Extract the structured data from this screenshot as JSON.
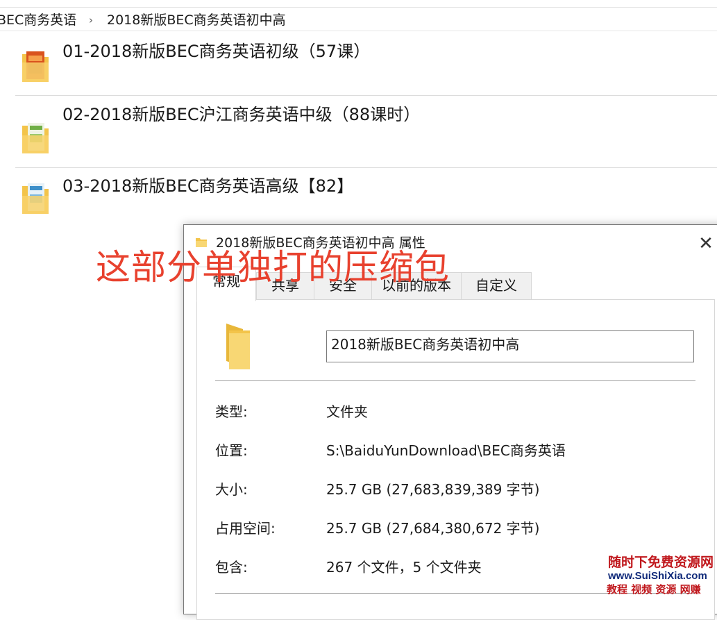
{
  "breadcrumb": {
    "parent": "BEC商务英语",
    "separator": "›",
    "current": "2018新版BEC商务英语初中高"
  },
  "folders": [
    {
      "name": "01-2018新版BEC商务英语初级（57课）",
      "icon": "folder-book-icon-orange"
    },
    {
      "name": "02-2018新版BEC沪江商务英语中级（88课时）",
      "icon": "folder-book-icon-green"
    },
    {
      "name": "03-2018新版BEC商务英语高级【82】",
      "icon": "folder-book-icon-blue"
    }
  ],
  "annotation": "这部分单独打的压缩包",
  "dialog": {
    "title": "2018新版BEC商务英语初中高 属性",
    "close_glyph": "✕",
    "tabs": [
      "常规",
      "共享",
      "安全",
      "以前的版本",
      "自定义"
    ],
    "active_tab": "常规",
    "folder_name": "2018新版BEC商务英语初中高",
    "properties": [
      {
        "label": "类型:",
        "value": "文件夹"
      },
      {
        "label": "位置:",
        "value": "S:\\BaiduYunDownload\\BEC商务英语"
      },
      {
        "label": "大小:",
        "value": "25.7 GB (27,683,839,389 字节)"
      },
      {
        "label": "占用空间:",
        "value": "25.7 GB (27,684,380,672 字节)"
      },
      {
        "label": "包含:",
        "value": "267 个文件，5 个文件夹"
      }
    ]
  },
  "watermark": {
    "line1": "随时下免费资源网",
    "line2": "www.SuiShiXia.com",
    "line3": "教程 视频 资源 网赚"
  },
  "colors": {
    "annotation": "#e8412e",
    "folder_yellow": "#f5c842",
    "watermark_red": "#c0181d",
    "watermark_blue": "#102a7a"
  }
}
